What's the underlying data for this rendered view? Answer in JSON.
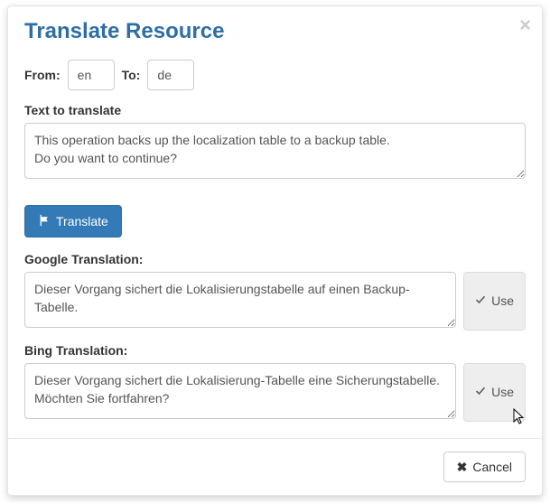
{
  "title": "Translate Resource",
  "from": {
    "label": "From:",
    "value": "en"
  },
  "to": {
    "label": "To:",
    "value": "de"
  },
  "source": {
    "label": "Text to translate",
    "value": "This operation backs up the localization table to a backup table.\nDo you want to continue?"
  },
  "translate_button": "Translate",
  "google": {
    "label": "Google Translation:",
    "value": "Dieser Vorgang sichert die Lokalisierungstabelle auf einen Backup-Tabelle.",
    "use": "Use"
  },
  "bing": {
    "label": "Bing Translation:",
    "value": "Dieser Vorgang sichert die Lokalisierung-Tabelle eine Sicherungstabelle. Möchten Sie fortfahren?",
    "use": "Use"
  },
  "cancel": "Cancel"
}
